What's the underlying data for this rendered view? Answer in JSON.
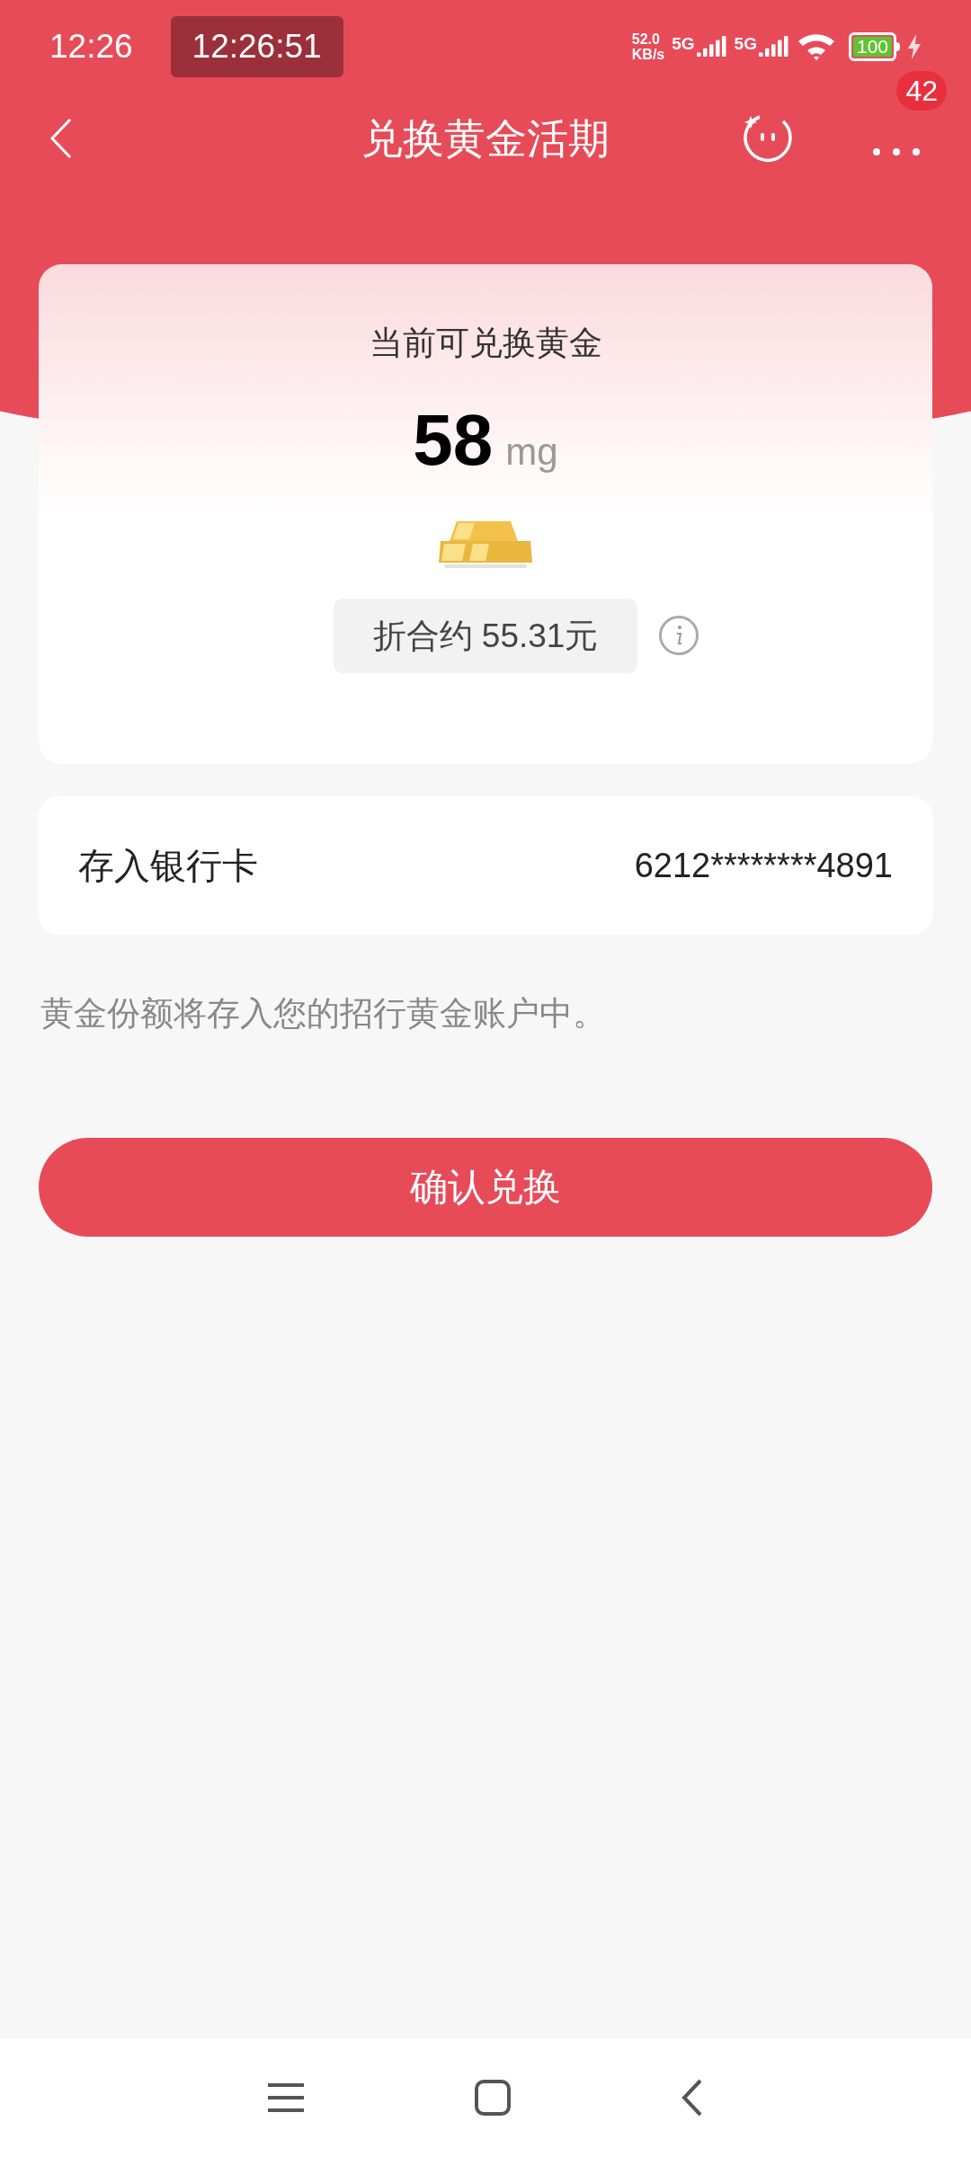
{
  "status_bar": {
    "time": "12:26",
    "clock_chip": "12:26:51",
    "network_speed": [
      "52.0",
      "KB/s"
    ],
    "network_types": [
      "5G",
      "5G"
    ],
    "battery": "100"
  },
  "nav": {
    "title": "兑换黄金活期",
    "badge": "42"
  },
  "gold_card": {
    "label": "当前可兑换黄金",
    "amount": "58",
    "unit": "mg",
    "equivalent": "折合约 55.31元"
  },
  "bank_row": {
    "label": "存入银行卡",
    "value": "6212********4891"
  },
  "note": "黄金份额将存入您的招行黄金账户中。",
  "confirm_button": "确认兑换"
}
